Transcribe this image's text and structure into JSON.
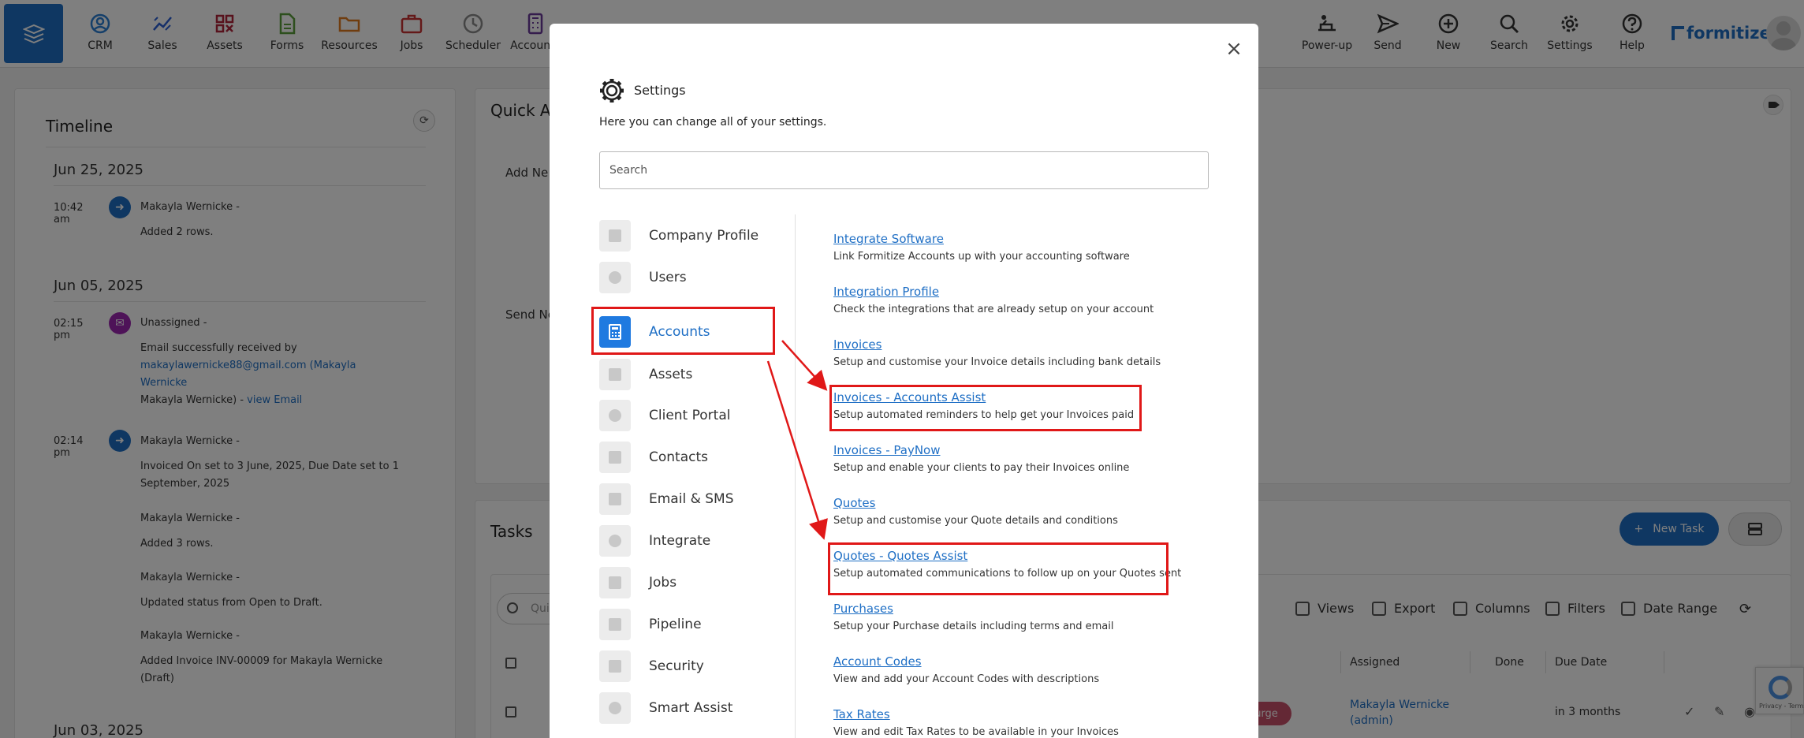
{
  "nav": {
    "items": [
      {
        "label": "CRM",
        "icon": "crm-icon",
        "color": "#2a7fd4"
      },
      {
        "label": "Sales",
        "icon": "sales-icon",
        "color": "#2a5fd4"
      },
      {
        "label": "Assets",
        "icon": "assets-icon",
        "color": "#b0243b"
      },
      {
        "label": "Forms",
        "icon": "forms-icon",
        "color": "#5a9e3a"
      },
      {
        "label": "Resources",
        "icon": "resources-icon",
        "color": "#e07b1e"
      },
      {
        "label": "Jobs",
        "icon": "jobs-icon",
        "color": "#c83333"
      },
      {
        "label": "Scheduler",
        "icon": "scheduler-icon",
        "color": "#8a8a8a"
      },
      {
        "label": "Accounts",
        "icon": "accounts-icon",
        "color": "#6a3a9a"
      }
    ],
    "right_items": [
      {
        "label": "Power-up",
        "icon": "power-up-icon"
      },
      {
        "label": "Send",
        "icon": "send-icon"
      },
      {
        "label": "New",
        "icon": "new-icon"
      },
      {
        "label": "Search",
        "icon": "search-icon"
      },
      {
        "label": "Settings",
        "icon": "settings-icon"
      },
      {
        "label": "Help",
        "icon": "help-icon"
      }
    ],
    "logo": "formitize"
  },
  "timeline": {
    "title": "Timeline",
    "groups": [
      {
        "date": "Jun 25, 2025"
      },
      {
        "date": "Jun 05, 2025"
      },
      {
        "date": "Jun 03, 2025"
      }
    ],
    "entries": [
      {
        "time": "10:42 am",
        "who": "Makayla Wernicke -",
        "text": "Added 2 rows."
      },
      {
        "time": "02:15 pm",
        "who": "Unassigned -",
        "text1": "Email successfully received by",
        "email": "makaylawernicke88@gmail.com",
        "name_link": "(Makayla Wernicke",
        "text2": "Makayla Wernicke) -",
        "view_link": "view Email"
      },
      {
        "time": "02:14 pm",
        "who": "Makayla Wernicke -",
        "text1": "Invoiced On set to 3 June, 2025, Due Date set to 1",
        "text2": "September, 2025"
      },
      {
        "who": "Makayla Wernicke -",
        "text": "Added 3 rows."
      },
      {
        "who": "Makayla Wernicke -",
        "text": "Updated status from Open to Draft."
      },
      {
        "who": "Makayla Wernicke -",
        "text1": "Added Invoice INV-00009 for Makayla Wernicke",
        "text2": "(Draft)"
      }
    ]
  },
  "quick_actions": {
    "title": "Quick Ac",
    "add_label": "Add Ne",
    "send_label": "Send Ne"
  },
  "tasks": {
    "title": "Tasks",
    "new_task": "New Task",
    "search_placeholder": "Qui",
    "toolbar": [
      "Views",
      "Export",
      "Columns",
      "Filters",
      "Date Range"
    ],
    "columns": {
      "assigned": "Assigned",
      "done": "Done",
      "due": "Due Date"
    },
    "row": {
      "pill": "urge",
      "assigned_line1": "Makayla Wernicke",
      "assigned_line2": "(admin)",
      "due": "in 3 months"
    }
  },
  "recaptcha": "Privacy - Terms",
  "modal": {
    "title": "Settings",
    "subtitle": "Here you can change all of your settings.",
    "search_placeholder": "Search",
    "categories": [
      {
        "label": "Company Profile",
        "icon": "company-icon"
      },
      {
        "label": "Users",
        "icon": "users-icon"
      },
      {
        "label": "Accounts",
        "icon": "calculator-icon",
        "active": true
      },
      {
        "label": "Assets",
        "icon": "assets-icon"
      },
      {
        "label": "Client Portal",
        "icon": "globe-icon"
      },
      {
        "label": "Contacts",
        "icon": "contacts-icon"
      },
      {
        "label": "Email & SMS",
        "icon": "chat-icon"
      },
      {
        "label": "Integrate",
        "icon": "integrate-icon"
      },
      {
        "label": "Jobs",
        "icon": "briefcase-icon"
      },
      {
        "label": "Pipeline",
        "icon": "funnel-icon"
      },
      {
        "label": "Security",
        "icon": "lock-icon"
      },
      {
        "label": "Smart Assist",
        "icon": "smart-assist-icon"
      }
    ],
    "links": [
      {
        "title": "Integrate Software",
        "desc": "Link Formitize Accounts up with your accounting software"
      },
      {
        "title": "Integration Profile",
        "desc": "Check the integrations that are already setup on your account"
      },
      {
        "title": "Invoices",
        "desc": "Setup and customise your Invoice details including bank details"
      },
      {
        "title": "Invoices - Accounts Assist",
        "desc": "Setup automated reminders to help get your Invoices paid"
      },
      {
        "title": "Invoices - PayNow",
        "desc": "Setup and enable your clients to pay their Invoices online"
      },
      {
        "title": "Quotes",
        "desc": "Setup and customise your Quote details and conditions"
      },
      {
        "title": "Quotes - Quotes Assist",
        "desc": "Setup automated communications to follow up on your Quotes sent"
      },
      {
        "title": "Purchases",
        "desc": "Setup your Purchase details including terms and email"
      },
      {
        "title": "Account Codes",
        "desc": "View and add your Account Codes with descriptions"
      },
      {
        "title": "Tax Rates",
        "desc": "View and edit Tax Rates to be available in your Invoices"
      }
    ]
  },
  "colors": {
    "brand": "#1f6fc5",
    "annotation": "#e01818"
  }
}
